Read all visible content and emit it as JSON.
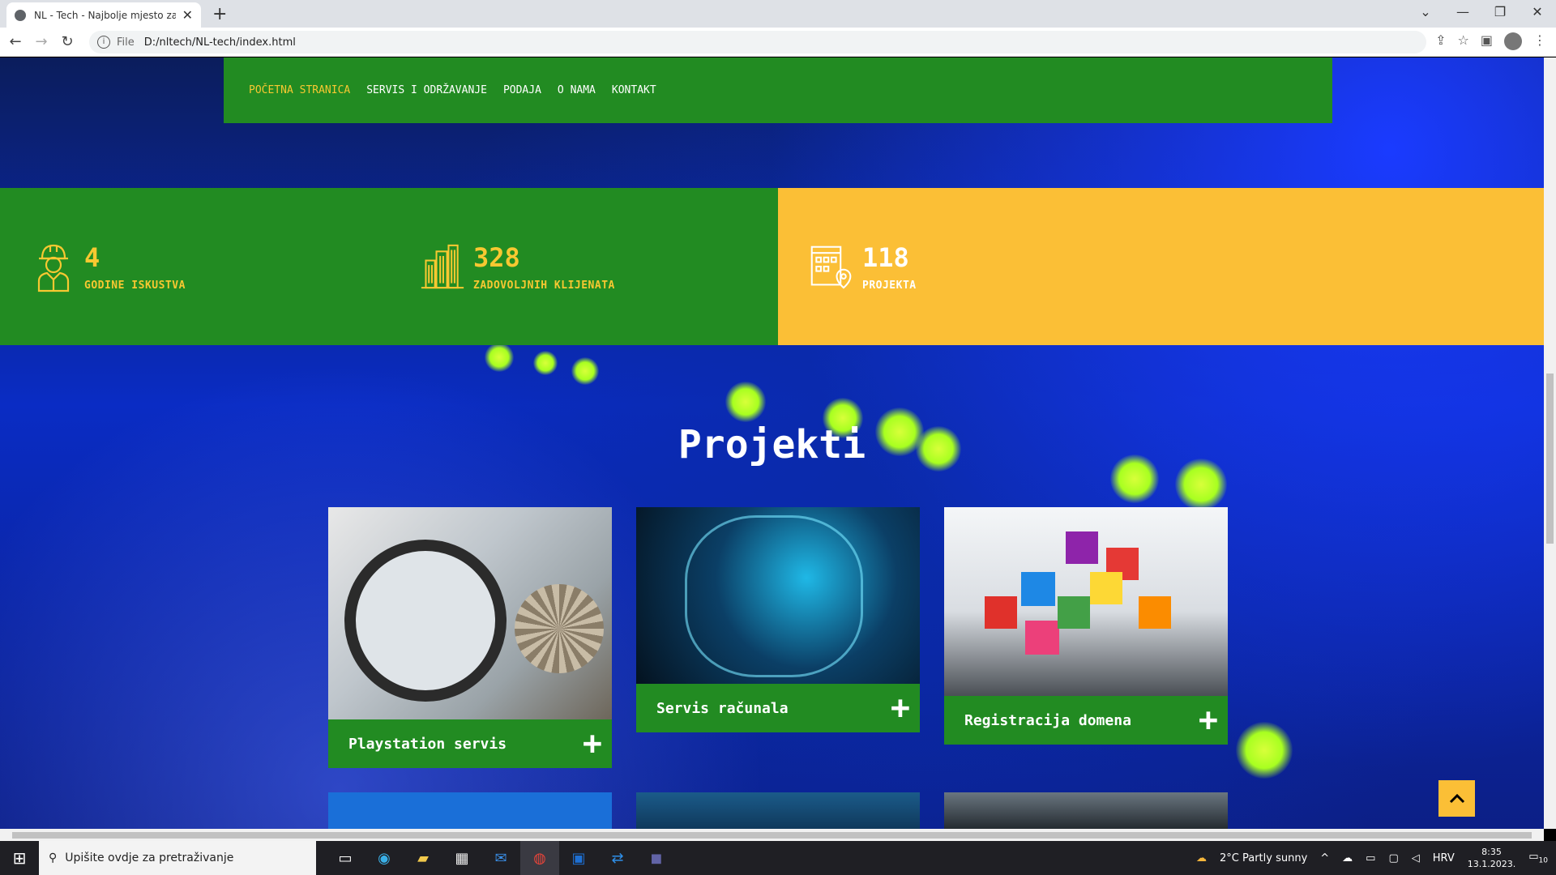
{
  "browser": {
    "tab_title": "NL - Tech - Najbolje mjesto za v",
    "url_scheme": "File",
    "url": "D:/nltech/NL-tech/index.html"
  },
  "nav": {
    "items": [
      "POČETNA STRANICA",
      "SERVIS I ODRŽAVANJE",
      "PODAJA",
      "O NAMA",
      "KONTAKT"
    ]
  },
  "stats": [
    {
      "num": "4",
      "label": "GODINE ISKUSTVA",
      "icon": "worker-icon"
    },
    {
      "num": "328",
      "label": "ZADOVOLJNIH KLIJENATA",
      "icon": "city-buildings-icon"
    },
    {
      "num": "118",
      "label": "PROJEKTA",
      "icon": "building-location-icon"
    }
  ],
  "section": {
    "title": "Projekti"
  },
  "projects": [
    {
      "title": "Playstation servis"
    },
    {
      "title": "Servis računala"
    },
    {
      "title": "Registracija domena"
    }
  ],
  "taskbar": {
    "search_placeholder": "Upišite ovdje za pretraživanje",
    "weather": "2°C  Partly sunny",
    "lang": "HRV",
    "time": "8:35",
    "date": "13.1.2023.",
    "notifications": "10"
  },
  "colors": {
    "green": "#228b22",
    "yellow": "#fbbf36",
    "accent": "#f7c831"
  }
}
